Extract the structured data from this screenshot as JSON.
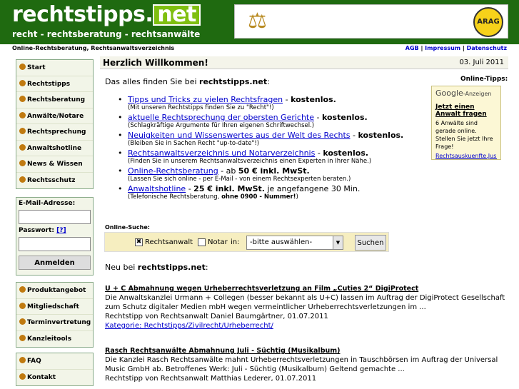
{
  "header": {
    "logo_main": "rechtstipps.",
    "logo_net": "net",
    "tagline": "recht - rechtsberatung - rechtsanwälte",
    "banner_brand": "ARAG"
  },
  "subbar": {
    "left": "Online-Rechtsberatung, Rechtsanwaltsverzeichnis",
    "links": [
      "AGB",
      "Impressum",
      "Datenschutz"
    ],
    "sep": "|"
  },
  "nav": {
    "items": [
      "Start",
      "Rechtstipps",
      "Rechtsberatung",
      "Anwälte/Notare",
      "Rechtsprechung",
      "Anwaltshotline",
      "News & Wissen",
      "Rechtsschutz"
    ]
  },
  "login": {
    "email_label": "E-Mail-Adresse:",
    "password_label": "Passwort:",
    "help": "[?]",
    "button": "Anmelden"
  },
  "nav2": {
    "items": [
      "Produktangebot",
      "Mitgliedschaft",
      "Terminvertretung",
      "Kanzleitools"
    ]
  },
  "nav3": {
    "items": [
      "FAQ",
      "Kontakt"
    ]
  },
  "main": {
    "title": "Herzlich Willkommen!",
    "date": "03. Juli 2011",
    "intro_prefix": "Das alles finden Sie bei ",
    "intro_site": "rechtstipps.net",
    "intro_suffix": ":",
    "features": [
      {
        "link": "Tipps und Tricks zu vielen Rechtsfragen",
        "sep": " - ",
        "extra": "kostenlos.",
        "note": "(Mit unseren Rechtstipps finden Sie zu \"Recht\"!)"
      },
      {
        "link": "aktuelle Rechtsprechung der obersten Gerichte",
        "sep": " - ",
        "extra": "kostenlos.",
        "note": "(Schlagkräftige Argumente für Ihren eigenen Schriftwechsel.)"
      },
      {
        "link": "Neuigkeiten und Wissenswertes aus der Welt des Rechts",
        "sep": " - ",
        "extra": "kostenlos.",
        "note": "(Bleiben Sie in Sachen Recht \"up-to-date\"!)"
      },
      {
        "link": "Rechtsanwaltsverzeichnis und Notarverzeichnis",
        "sep": " - ",
        "extra": "kostenlos.",
        "note": "(Finden Sie in unserem Rechtsanwaltsverzeichnis einen Experten in Ihrer Nähe.)"
      },
      {
        "link": "Online-Rechtsberatung",
        "sep": " - ab ",
        "extra": "50 € inkl. MwSt.",
        "note": "(Lassen Sie sich online - per E-Mail - von einem Rechtsexperten beraten.)"
      },
      {
        "link": "Anwaltshotline",
        "sep": " - ",
        "extra": "25 € inkl. MwSt.",
        "tail": " je angefangene 30 Min.",
        "note": "(Telefonische Rechtsberatung, ",
        "note_bold": "ohne 0900 - Nummer!",
        "note_end": ")"
      }
    ]
  },
  "sidebar_ad": {
    "label": "Online-Tipps:",
    "google": "Google",
    "anzeigen": "-Anzeigen",
    "title": "Jetzt einen Anwalt fragen",
    "text": "6 Anwälte sind gerade online. Stellen Sie jetzt Ihre Frage!",
    "url": "Rechtsauskuenfte.Jus..."
  },
  "search": {
    "label": "Online-Suche:",
    "opt1": "Rechtsanwalt",
    "opt1_checked": true,
    "opt2": "Notar",
    "in": "in:",
    "select_value": "-bitte auswählen-",
    "button": "Suchen"
  },
  "news": {
    "label_prefix": "Neu bei ",
    "label_site": "rechtstipps.net",
    "label_suffix": ":",
    "articles": [
      {
        "title": "U + C Abmahnung wegen Urheberrechtsverletzung an Film „Cuties 2“ DigiProtect",
        "body": "Die Anwaltskanzlei Urmann + Collegen (besser bekannt als U+C) lassen im Auftrag der DigiProtect Gesellschaft zum Schutz digitaler Medien mbH wegen vermeintlicher Urheberrechtsverletzungen im ...",
        "meta": "Rechtstipp von Rechtsanwalt Daniel Baumgärtner, 01.07.2011",
        "category": "Kategorie: Rechtstipps/Zivilrecht/Urheberrecht/"
      },
      {
        "title": "Rasch Rechtsanwälte Abmahnung Juli - Süchtig (Musikalbum)",
        "body": "Die Kanzlei Rasch Rechtsanwälte mahnt Urheberrechtsverletzungen in Tauschbörsen im Auftrag der Universal Music GmbH ab. Betroffenes Werk: Juli - Süchtig (Musikalbum) Geltend gemachte ...",
        "meta": "Rechtstipp von Rechtsanwalt Matthias Lederer, 01.07.2011"
      }
    ]
  }
}
